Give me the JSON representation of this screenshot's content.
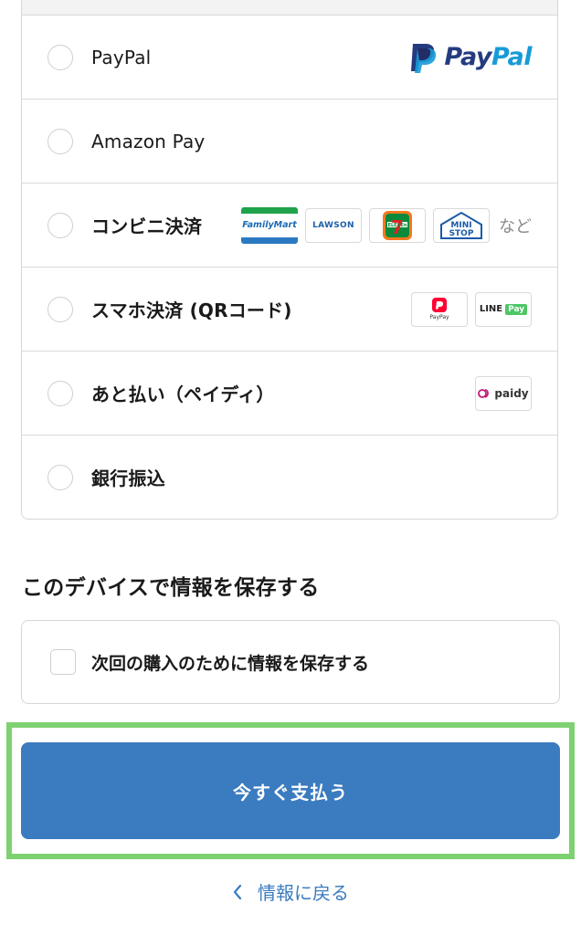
{
  "payment_methods": {
    "items": [
      {
        "label": "PayPal"
      },
      {
        "label": "Amazon Pay"
      },
      {
        "label": "コンビニ決済"
      },
      {
        "label": "スマホ決済 (QRコード)"
      },
      {
        "label": "あと払い（ペイディ）"
      },
      {
        "label": "銀行振込"
      }
    ],
    "paypal_logo": {
      "pay": "Pay",
      "pal": "Pal"
    },
    "convenience_logos": {
      "familymart": "FamilyMart",
      "lawson": "LAWSON",
      "seven_number": "7",
      "seven_text": "ELEVEn",
      "ministop_line1": "MINI",
      "ministop_line2": "STOP",
      "etc": "など"
    },
    "qr_logos": {
      "paypay": "PayPay",
      "line_pay_line": "LINE",
      "line_pay_pay": "Pay"
    },
    "paidy_logo": "paidy"
  },
  "save_section": {
    "heading": "このデバイスで情報を保存する",
    "checkbox_label": "次回の購入のために情報を保存する"
  },
  "pay_button": {
    "label": "今すぐ支払う"
  },
  "back_link": {
    "label": "情報に戻る"
  },
  "colors": {
    "primary": "#3b7bbf",
    "highlight": "#7ed170",
    "paypal_dark": "#253b80",
    "paypal_light": "#179bd7"
  },
  "icons": [
    "paypal-icon",
    "familymart-logo",
    "lawson-logo",
    "seven-eleven-logo",
    "ministop-logo",
    "paypay-logo",
    "line-pay-logo",
    "paidy-logo",
    "chevron-left-icon"
  ]
}
